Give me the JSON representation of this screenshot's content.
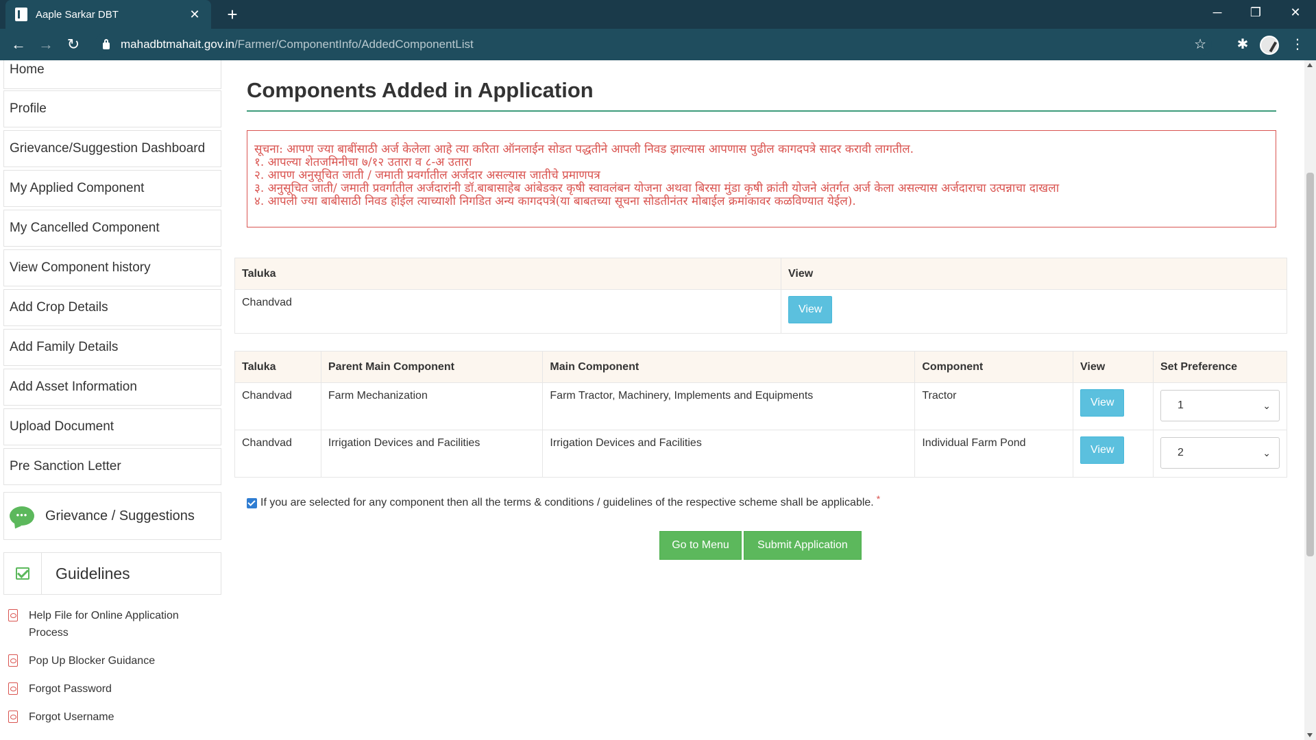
{
  "browser": {
    "tab_title": "Aaple Sarkar DBT",
    "tab_close": "✕",
    "new_tab": "+",
    "minimize": "─",
    "restore": "❐",
    "close": "✕",
    "url_host": "mahadbtmahait.gov.in",
    "url_path": "/Farmer/ComponentInfo/AddedComponentList",
    "back": "←",
    "forward": "→",
    "reload": "↻",
    "bookmark": "☆",
    "extensions": "✱",
    "menu": "⋮"
  },
  "sidebar": {
    "items": [
      {
        "label": "Home"
      },
      {
        "label": "Profile"
      },
      {
        "label": "Grievance/Suggestion Dashboard"
      },
      {
        "label": "My Applied Component"
      },
      {
        "label": "My Cancelled Component"
      },
      {
        "label": "View Component history"
      },
      {
        "label": "Add Crop Details"
      },
      {
        "label": "Add Family Details"
      },
      {
        "label": "Add Asset Information"
      },
      {
        "label": "Upload Document"
      },
      {
        "label": "Pre Sanction Letter"
      }
    ],
    "grievance_label": "Grievance / Suggestions",
    "guidelines_title": "Guidelines",
    "guideline_links": [
      {
        "label": "Help File for Online Application Process"
      },
      {
        "label": "Pop Up Blocker Guidance"
      },
      {
        "label": "Forgot Password"
      },
      {
        "label": "Forgot Username"
      }
    ]
  },
  "main": {
    "title": "Components Added in Application",
    "notice_lines": [
      "सूचना: आपण ज्या बाबींसाठी अर्ज केलेला आहे त्या करिता ऑनलाईन सोडत पद्धतीने आपली निवड झाल्यास आपणास पुढील कागदपत्रे सादर करावी लागतील.",
      "१. आपल्या शेतजमिनीचा ७/१२ उतारा व ८-अ उतारा",
      "२. आपण अनुसूचित जाती / जमाती प्रवर्गातील अर्जदार असल्यास जातीचे प्रमाणपत्र",
      "३. अनुसूचित जाती/ जमाती प्रवर्गातील अर्जदारांनी डॉ.बाबासाहेब आंबेडकर कृषी स्वावलंबन योजना अथवा बिरसा मुंडा कृषी क्रांती योजने अंतर्गत अर्ज केला असल्यास अर्जदाराचा उत्पन्नाचा दाखला",
      "४. आपली ज्या बाबीसाठी निवड होईल त्याच्याशी निगडित अन्य कागदपत्रे(या बाबतच्या सूचना सोडतीनंतर मोबाईल क्रमांकावर कळविण्यात येईल)."
    ],
    "taluka_table": {
      "headers": [
        "Taluka",
        "View"
      ],
      "taluka": "Chandvad",
      "view_label": "View"
    },
    "components_table": {
      "headers": [
        "Taluka",
        "Parent Main Component",
        "Main Component",
        "Component",
        "View",
        "Set Preference"
      ],
      "rows": [
        {
          "taluka": "Chandvad",
          "parent": "Farm Mechanization",
          "main": "Farm Tractor, Machinery, Implements and Equipments",
          "component": "Tractor",
          "view": "View",
          "preference": "1"
        },
        {
          "taluka": "Chandvad",
          "parent": "Irrigation Devices and Facilities",
          "main": "Irrigation Devices and Facilities",
          "component": "Individual Farm Pond",
          "view": "View",
          "preference": "2"
        }
      ]
    },
    "terms_checked": true,
    "terms_text": "If you are selected for any component then all the terms & conditions / guidelines of the respective scheme shall be applicable.",
    "required_mark": "*",
    "go_to_menu": "Go to Menu",
    "submit": "Submit Application"
  },
  "colors": {
    "chrome_dark": "#1a3a4a",
    "chrome": "#1f4d5e",
    "accent_green": "#5cb85c",
    "info_blue": "#5bc0de",
    "notice_red": "#d9534f",
    "title_rule": "#3c9b7a"
  }
}
